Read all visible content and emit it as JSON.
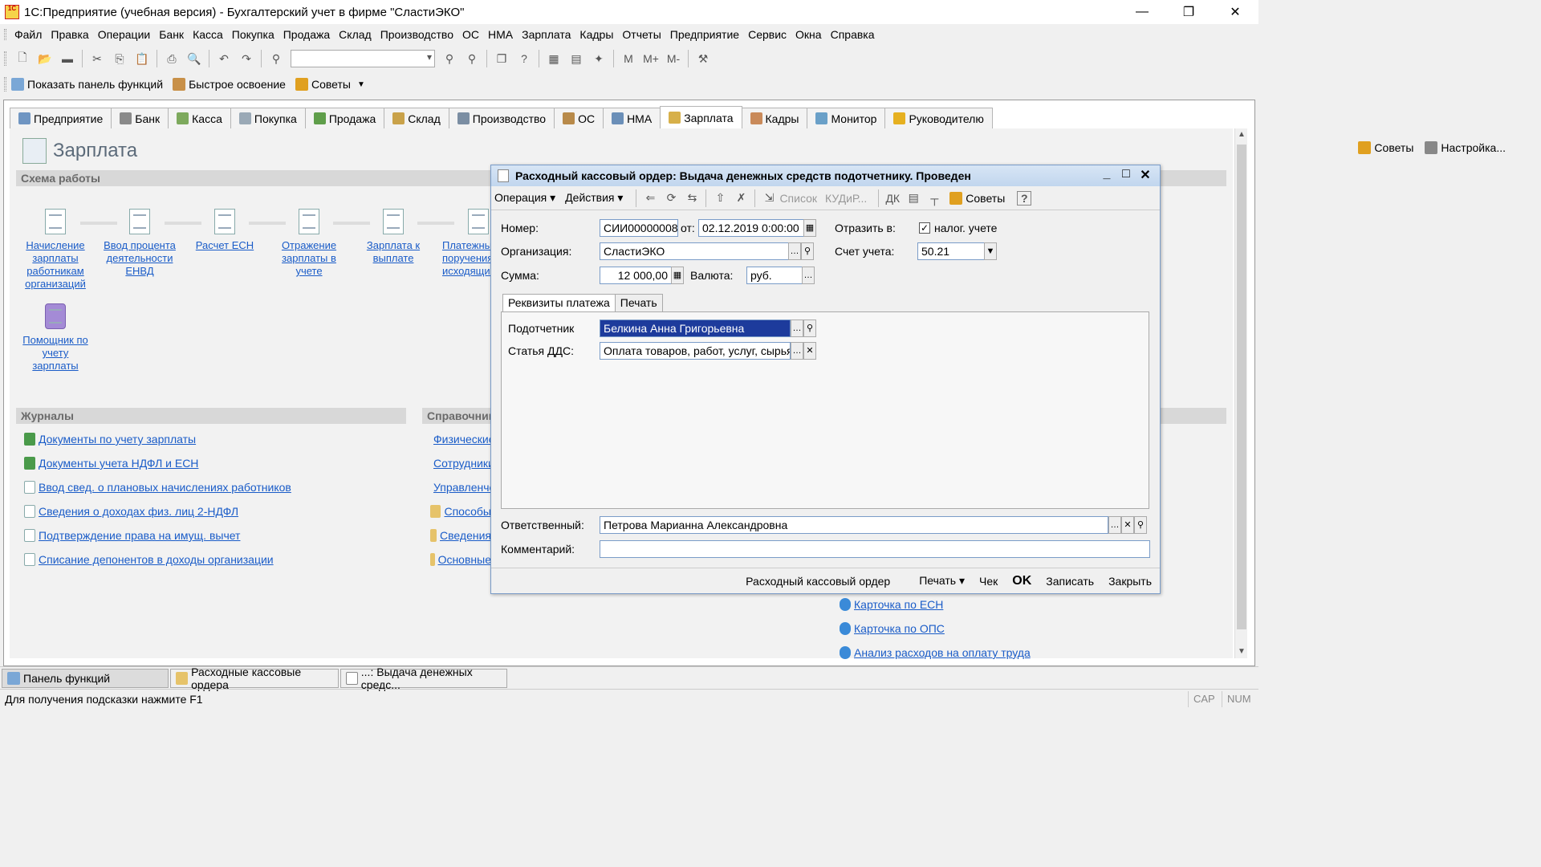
{
  "window": {
    "title": "1С:Предприятие (учебная версия) - Бухгалтерский учет в фирме \"СластиЭКО\"",
    "app_icon": "1С"
  },
  "menu": [
    "Файл",
    "Правка",
    "Операции",
    "Банк",
    "Касса",
    "Покупка",
    "Продажа",
    "Склад",
    "Производство",
    "ОС",
    "НМА",
    "Зарплата",
    "Кадры",
    "Отчеты",
    "Предприятие",
    "Сервис",
    "Окна",
    "Справка"
  ],
  "toolbar2": {
    "show_panel": "Показать панель функций",
    "quick_learn": "Быстрое освоение",
    "tips": "Советы"
  },
  "toolbar1": {
    "m1": "M",
    "m2": "M+",
    "m3": "M-"
  },
  "tabs": [
    "Предприятие",
    "Банк",
    "Касса",
    "Покупка",
    "Продажа",
    "Склад",
    "Производство",
    "ОС",
    "НМА",
    "Зарплата",
    "Кадры",
    "Монитор",
    "Руководителю"
  ],
  "page": {
    "title": "Зарплата",
    "tips": "Советы",
    "settings": "Настройка...",
    "schema_head": "Схема работы",
    "schema_items": [
      "Начисление зарплаты работникам организаций",
      "Ввод процента деятельности ЕНВД",
      "Расчет ЕСН",
      "Отражение зарплаты в учете",
      "Зарплата к выплате",
      "Платежные поручения исходящие"
    ],
    "helper": "Помощник по учету зарплаты",
    "journals_head": "Журналы",
    "journals": [
      "Документы по учету зарплаты",
      "Документы учета НДФЛ и ЕСН",
      "Ввод свед. о плановых начислениях работников",
      "Сведения о доходах физ. лиц 2-НДФЛ",
      "Подтверждение права на имущ. вычет",
      "Списание депонентов в доходы организации"
    ],
    "refs_head": "Справочники",
    "refs": [
      "Физические лица",
      "Сотрудники",
      "Управленческие",
      "Способы",
      "Сведения",
      "Основные"
    ],
    "reports": [
      "Карточка по ЕСН",
      "Карточка по ОПС",
      "Анализ расходов на оплату труда"
    ]
  },
  "dialog": {
    "title": "Расходный кассовый ордер: Выдача денежных средств подотчетнику. Проведен",
    "menu": [
      "Операция",
      "Действия"
    ],
    "list": "Список",
    "kud": "КУДиР...",
    "tips": "Советы",
    "help": "?",
    "number_label": "Номер:",
    "number": "СИИ00000008",
    "from_label": "от:",
    "date": "02.12.2019 0:00:00",
    "reflect_label": "Отразить в:",
    "tax_accounting": "налог. учете",
    "tax_checked": true,
    "org_label": "Организация:",
    "org": "СластиЭКО",
    "account_label": "Счет учета:",
    "account": "50.21",
    "sum_label": "Сумма:",
    "sum": "12 000,00",
    "currency_label": "Валюта:",
    "currency": "руб.",
    "tabs": [
      "Реквизиты платежа",
      "Печать"
    ],
    "accountable_label": "Подотчетник",
    "accountable": "Белкина Анна Григорьевна",
    "dds_label": "Статья ДДС:",
    "dds": "Оплата товаров, работ, услуг, сырья",
    "responsible_label": "Ответственный:",
    "responsible": "Петрова Марианна Александровна",
    "comment_label": "Комментарий:",
    "comment": "",
    "footer": {
      "doc": "Расходный кассовый ордер",
      "print": "Печать",
      "check": "Чек",
      "ok": "OK",
      "save": "Записать",
      "close": "Закрыть"
    }
  },
  "taskbar": [
    "Панель функций",
    "Расходные кассовые ордера",
    "...: Выдача денежных средс..."
  ],
  "status": {
    "hint": "Для получения подсказки нажмите F1",
    "cap": "CAP",
    "num": "NUM"
  }
}
